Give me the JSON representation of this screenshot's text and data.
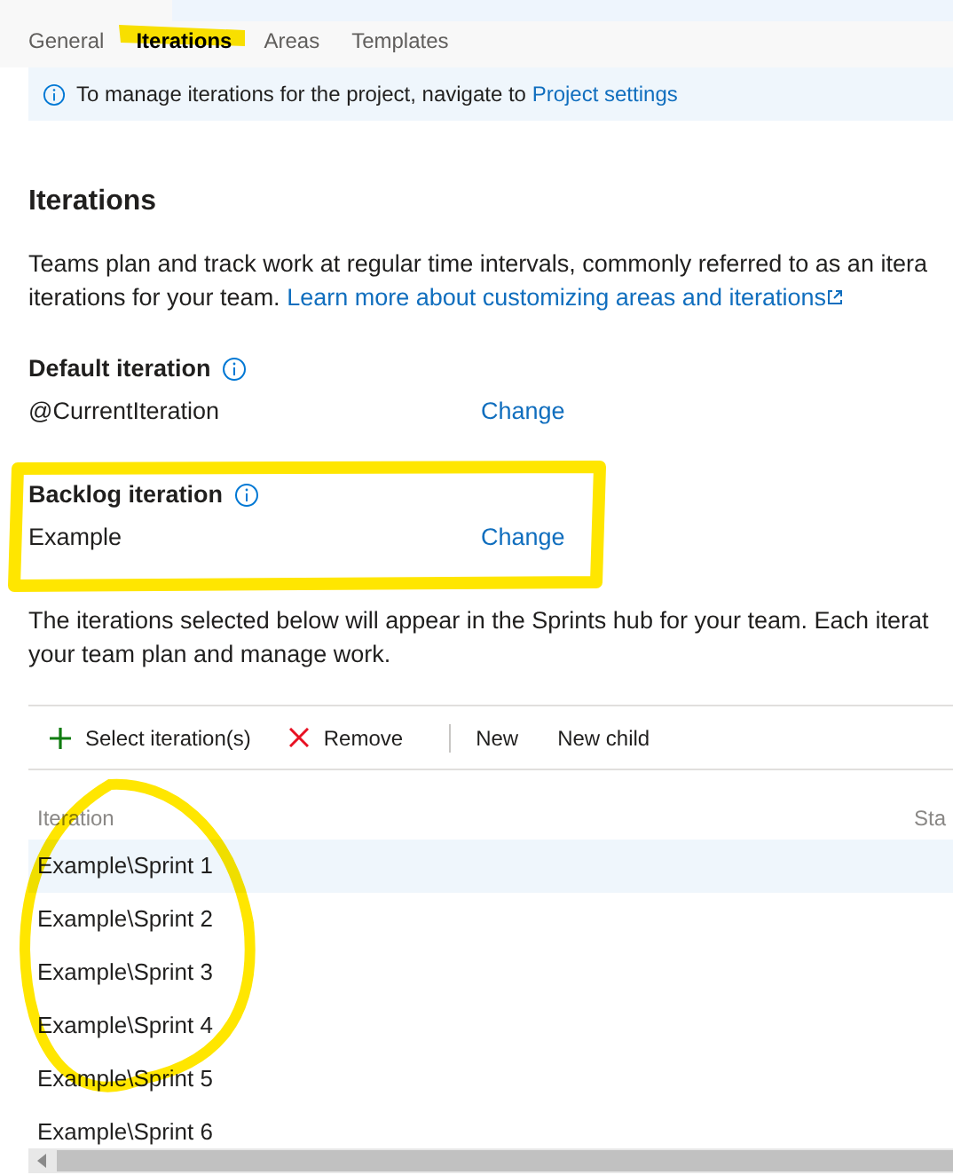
{
  "tabs": [
    {
      "label": "General",
      "selected": false
    },
    {
      "label": "Iterations",
      "selected": true
    },
    {
      "label": "Areas",
      "selected": false
    },
    {
      "label": "Templates",
      "selected": false
    }
  ],
  "info_bar": {
    "text": "To manage iterations for the project, navigate to ",
    "link": "Project settings"
  },
  "section_title": "Iterations",
  "description": {
    "line_1": "Teams plan and track work at regular time intervals, commonly referred to as an itera",
    "line_2": "iterations for your team. ",
    "link": "Learn more about customizing areas and iterations"
  },
  "settings": [
    {
      "label": "Default iteration",
      "value": "@CurrentIteration",
      "action": "Change"
    },
    {
      "label": "Backlog iteration",
      "value": "Example",
      "action": "Change"
    }
  ],
  "selection_note": {
    "line_1": "The iterations selected below will appear in the Sprints hub for your team. Each iterat",
    "line_2": "your team plan and manage work."
  },
  "toolbar": [
    {
      "kind": "add",
      "label": "Select iteration(s)"
    },
    {
      "kind": "remove",
      "label": "Remove"
    },
    {
      "kind": "separator"
    },
    {
      "kind": "plain",
      "label": "New"
    },
    {
      "kind": "plain",
      "label": "New child"
    }
  ],
  "table": {
    "columns": [
      "Iteration",
      "Sta"
    ],
    "rows": [
      {
        "iteration": "Example\\Sprint 1",
        "selected": true
      },
      {
        "iteration": "Example\\Sprint 2",
        "selected": false
      },
      {
        "iteration": "Example\\Sprint 3",
        "selected": false
      },
      {
        "iteration": "Example\\Sprint 4",
        "selected": false
      },
      {
        "iteration": "Example\\Sprint 5",
        "selected": false
      },
      {
        "iteration": "Example\\Sprint 6",
        "selected": false
      }
    ]
  }
}
